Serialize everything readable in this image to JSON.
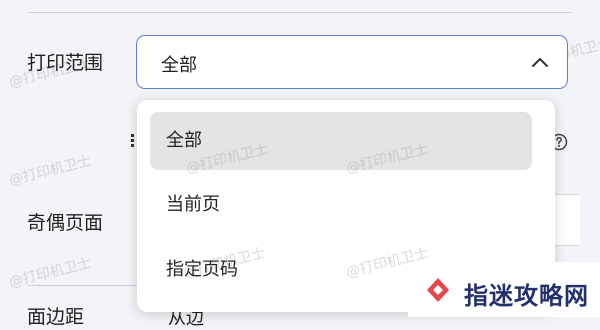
{
  "settings": {
    "print_range_label": "打印范围",
    "parity_label": "奇偶页面",
    "cut_label": "面边距",
    "cut_value": "从边"
  },
  "select": {
    "value": "全部",
    "border_color": "#5b80d6"
  },
  "dropdown": {
    "options": [
      "全部",
      "当前页",
      "指定页码"
    ],
    "selected_index": 0
  },
  "watermark": "@打印机卫士",
  "brand": {
    "text": "指迷攻略网",
    "logo_color": "#e8454a"
  }
}
